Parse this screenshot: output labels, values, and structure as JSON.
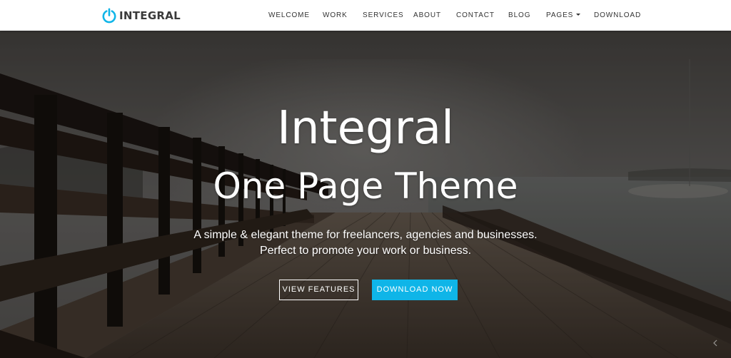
{
  "brand": {
    "name": "INTEGRAL",
    "icon": "power-icon",
    "accent_color": "#0fb5e8"
  },
  "nav": {
    "items": [
      {
        "label": "WELCOME"
      },
      {
        "label": "WORK"
      },
      {
        "label": "SERVICES"
      },
      {
        "label": "ABOUT"
      },
      {
        "label": "CONTACT"
      },
      {
        "label": "BLOG"
      },
      {
        "label": "PAGES",
        "has_dropdown": true
      },
      {
        "label": "DOWNLOAD"
      }
    ]
  },
  "hero": {
    "title_line1": "Integral",
    "title_line2": "One Page Theme",
    "subtitle_line1": "A simple & elegant theme for freelancers, agencies and businesses.",
    "subtitle_line2": "Perfect to promote your work or business.",
    "buttons": {
      "features_label": "VIEW FEATURES",
      "download_label": "DOWNLOAD NOW"
    },
    "button_color": "#0fb5e8"
  }
}
